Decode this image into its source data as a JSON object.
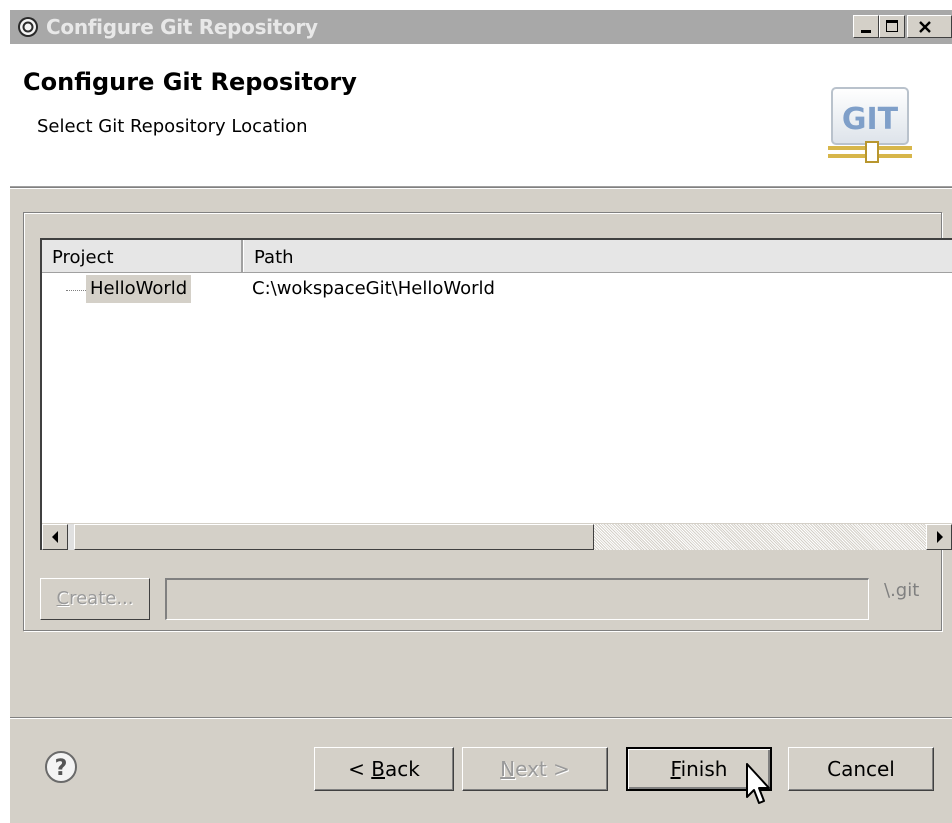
{
  "window": {
    "title": "Configure Git Repository",
    "controls": [
      "minimize",
      "maximize",
      "close"
    ]
  },
  "header": {
    "title": "Configure Git Repository",
    "subtitle": "Select Git Repository Location",
    "logo_text": "GIT"
  },
  "table": {
    "columns": [
      "Project",
      "Path"
    ],
    "rows": [
      {
        "project": "HelloWorld",
        "path": "C:\\wokspaceGit\\HelloWorld"
      }
    ]
  },
  "create": {
    "button_label": "Create...",
    "mnemonic": "C",
    "rest": "reate...",
    "field_value": "",
    "suffix": "\\.git"
  },
  "buttons": {
    "back": {
      "prefix": "< ",
      "mnemonic": "B",
      "rest": "ack",
      "enabled": true
    },
    "next": {
      "mnemonic": "N",
      "rest": "ext >",
      "enabled": false
    },
    "finish": {
      "mnemonic": "F",
      "rest": "inish",
      "enabled": true,
      "default": true
    },
    "cancel": {
      "label": "Cancel",
      "enabled": true
    }
  },
  "colors": {
    "dialog_bg": "#d4d0c8",
    "titlebar_inactive": "#a8a8a8",
    "logo_gold": "#d7b64a",
    "logo_blue": "#7f9fc9"
  }
}
